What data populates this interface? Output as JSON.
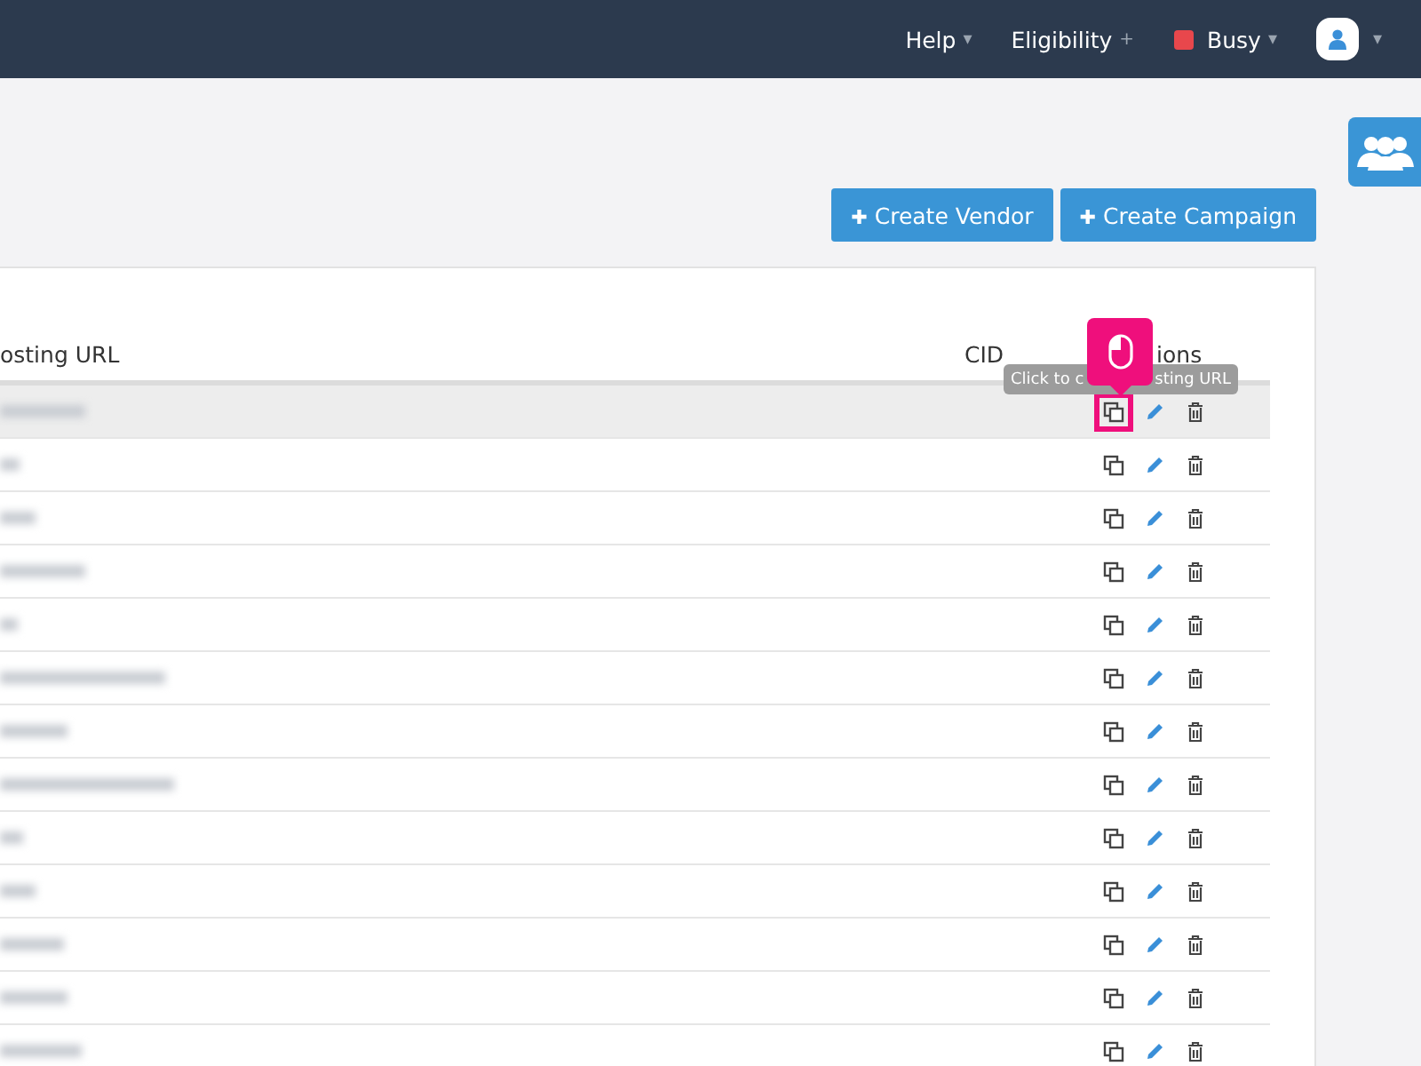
{
  "navbar": {
    "menus": [
      {
        "label": "Help",
        "kind": "dropdown",
        "caret": "▾"
      },
      {
        "label": "Eligibility",
        "kind": "add",
        "caret": "+"
      },
      {
        "label": "Busy",
        "kind": "status",
        "color": "#e8474c",
        "caret": "▾"
      },
      {
        "kind": "avatar",
        "caret": "▾"
      }
    ]
  },
  "buttons": [
    {
      "icon": "✚",
      "label": "Create Vendor"
    },
    {
      "icon": "✚",
      "label": "Create Campaign"
    }
  ],
  "table": {
    "columns": [
      "osting URL",
      "CID",
      "ions"
    ],
    "tooltip": [
      "Click to c",
      "sting URL"
    ],
    "rows": [
      {
        "highlighted": true,
        "pointer": true
      },
      {
        "highlighted": false,
        "pointer": false
      },
      {
        "highlighted": false,
        "pointer": false
      },
      {
        "highlighted": false,
        "pointer": false
      },
      {
        "highlighted": false,
        "pointer": false
      },
      {
        "highlighted": false,
        "pointer": false
      },
      {
        "highlighted": false,
        "pointer": false
      },
      {
        "highlighted": false,
        "pointer": false
      },
      {
        "highlighted": false,
        "pointer": false
      },
      {
        "highlighted": false,
        "pointer": false
      },
      {
        "highlighted": false,
        "pointer": false
      },
      {
        "highlighted": false,
        "pointer": false
      },
      {
        "highlighted": false,
        "pointer": false
      }
    ]
  }
}
